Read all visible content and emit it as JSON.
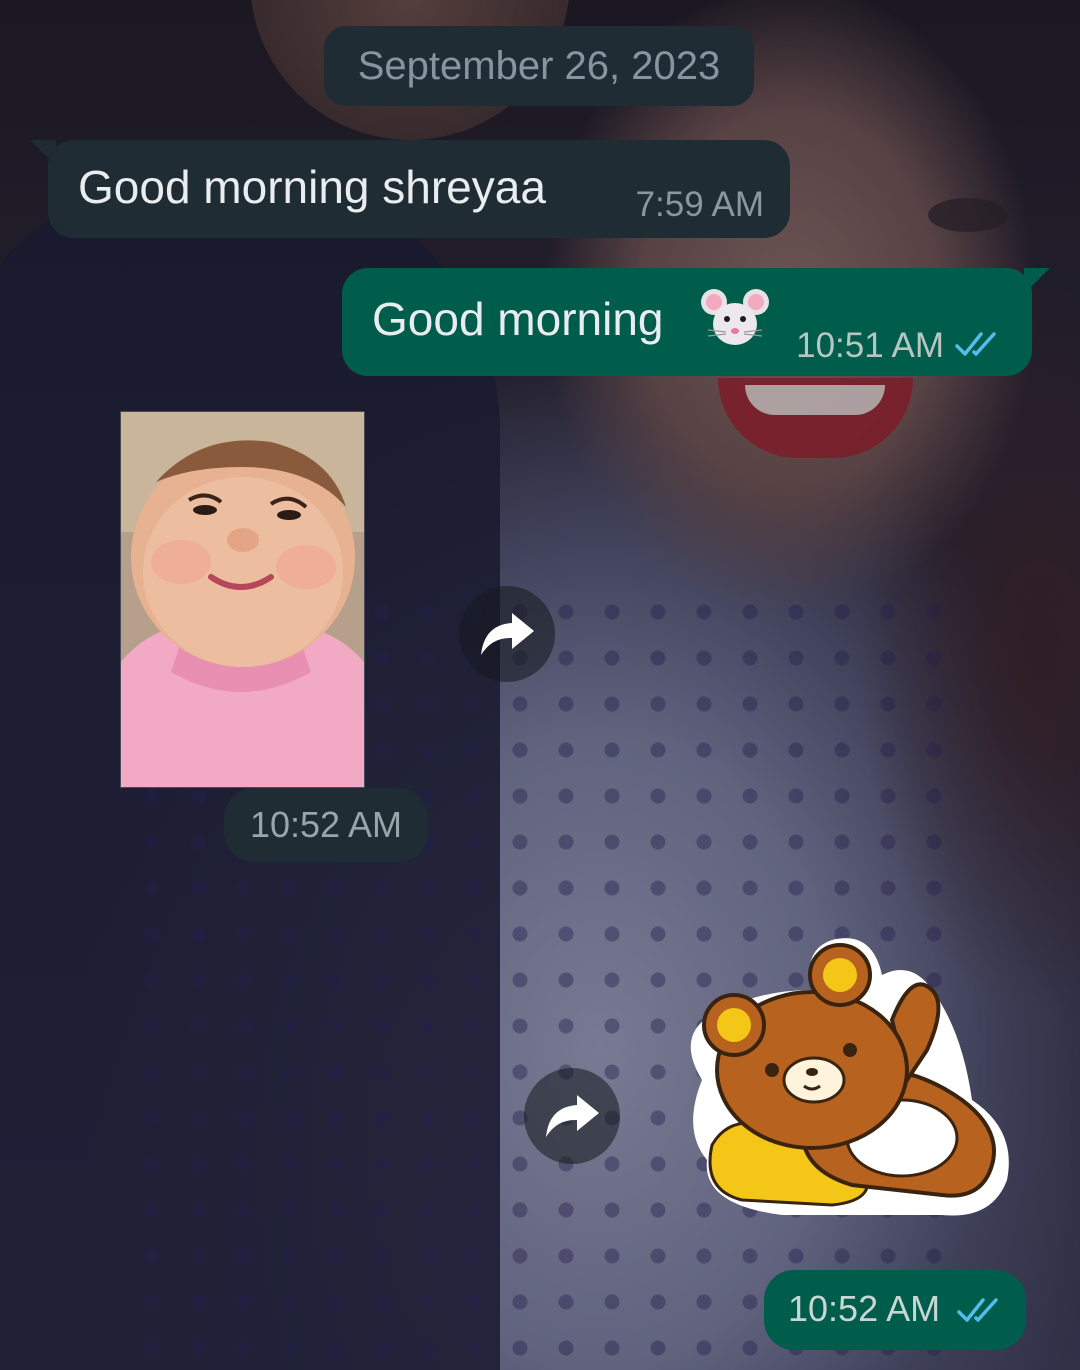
{
  "date_separator": "September 26, 2023",
  "messages": [
    {
      "direction": "incoming",
      "text": "Good morning shreyaa",
      "time": "7:59 AM"
    },
    {
      "direction": "outgoing",
      "text": "Good morning",
      "emoji": "mouse-face",
      "time": "10:51 AM",
      "status": "read"
    },
    {
      "direction": "incoming",
      "type": "image",
      "content": "baby-photo",
      "time": "10:52 AM"
    },
    {
      "direction": "outgoing",
      "type": "sticker",
      "content": "brown-bear-sticker",
      "time": "10:52 AM",
      "status": "read"
    }
  ],
  "colors": {
    "incoming_bubble": "#1f2c34",
    "outgoing_bubble": "#005c4b",
    "read_ticks": "#53bdeb",
    "text": "#e9edef"
  },
  "icons": {
    "forward": "forward-arrow-icon",
    "read_receipt": "double-check-icon"
  }
}
